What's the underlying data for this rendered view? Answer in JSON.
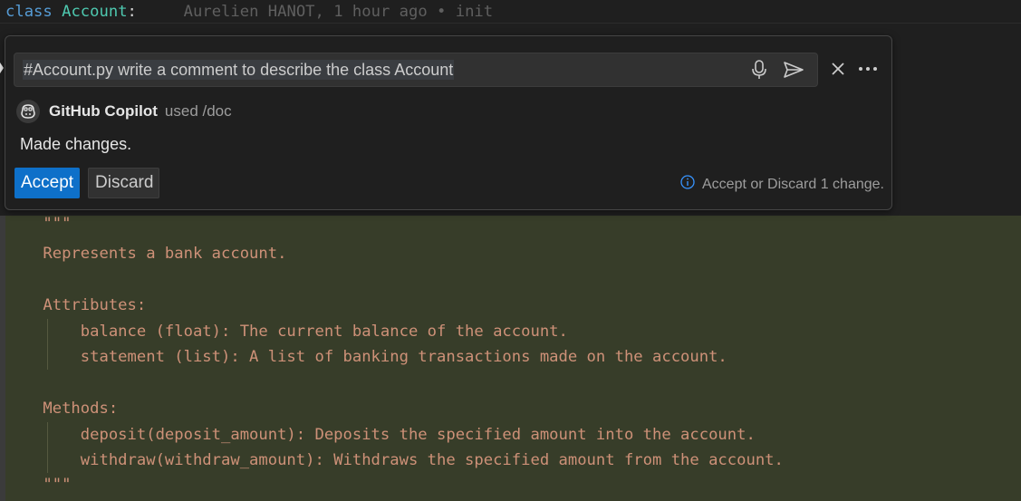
{
  "editor": {
    "class_keyword": "class",
    "class_name": "Account",
    "class_colon": ":",
    "blame": "Aurelien HANOT, 1 hour ago • init",
    "doc_lines": [
      "    \"\"\"",
      "    Represents a bank account.",
      "",
      "    Attributes:",
      "        balance (float): The current balance of the account.",
      "        statement (list): A list of banking transactions made on the account.",
      "",
      "    Methods:",
      "        deposit(deposit_amount): Deposits the specified amount into the account.",
      "        withdraw(withdraw_amount): Withdraws the specified amount from the account.",
      "    \"\"\""
    ]
  },
  "chat": {
    "prompt": "#Account.py write a comment to describe the class Account",
    "agent_name": "GitHub Copilot",
    "agent_used": "used /doc",
    "message": "Made changes.",
    "accept_label": "Accept",
    "discard_label": "Discard",
    "hint": "Accept or Discard 1 change.",
    "icons": [
      "microphone-icon",
      "send-icon",
      "close-icon",
      "more-icon",
      "copilot-icon",
      "info-icon"
    ]
  },
  "colors": {
    "keyword": "#569cd6",
    "class_name": "#4ec9b0",
    "docstring": "#ce9178",
    "diff_background": "#373d29",
    "accept_button": "#0e70c9"
  }
}
